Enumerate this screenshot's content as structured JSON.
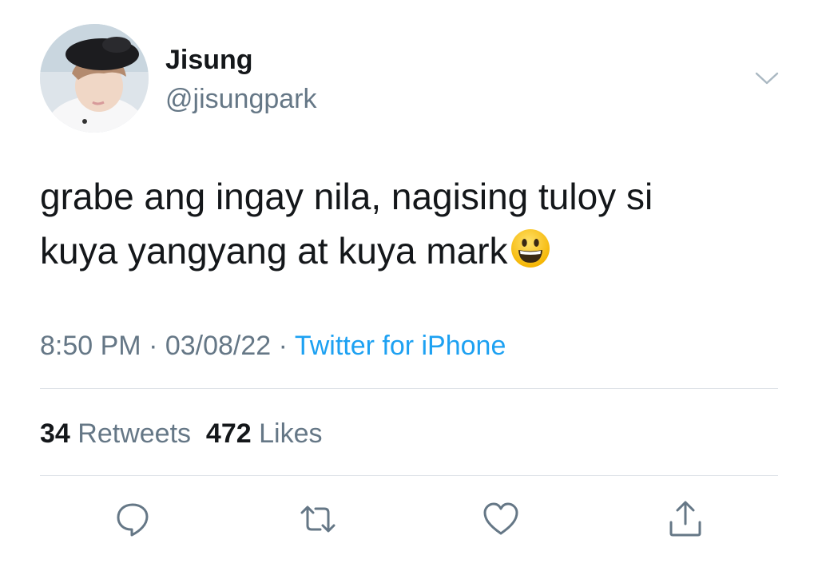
{
  "user": {
    "display_name": "Jisung",
    "handle": "@jisungpark"
  },
  "tweet": {
    "text_line1": "grabe ang ingay nila, nagising tuloy si",
    "text_line2": "kuya yangyang at kuya mark",
    "emoji": "grinning-face"
  },
  "meta": {
    "time": "8:50 PM",
    "separator": " · ",
    "date": "03/08/22",
    "source": "Twitter for iPhone"
  },
  "stats": {
    "retweets_count": "34",
    "retweets_label": "Retweets",
    "likes_count": "472",
    "likes_label": "Likes"
  },
  "actions": [
    "reply-icon",
    "retweet-icon",
    "like-icon",
    "share-icon"
  ],
  "colors": {
    "text": "#14171a",
    "secondary": "#657786",
    "link": "#1da1f2",
    "divider": "#dfe3e8"
  }
}
